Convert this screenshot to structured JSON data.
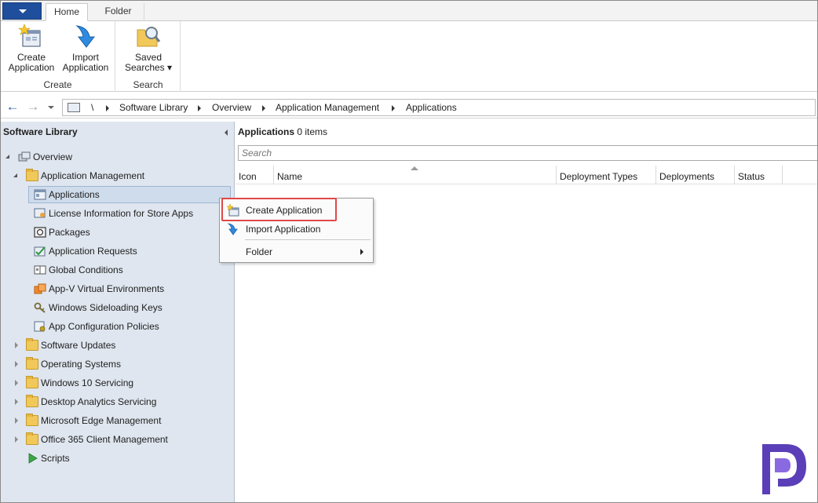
{
  "ribbon": {
    "tabs": [
      {
        "label": "Home",
        "active": true
      },
      {
        "label": "Folder",
        "active": false
      }
    ],
    "groups": {
      "create": {
        "label": "Create",
        "buttons": [
          {
            "label_line1": "Create",
            "label_line2": "Application",
            "icon": "create-application-icon"
          },
          {
            "label_line1": "Import",
            "label_line2": "Application",
            "icon": "import-application-icon"
          }
        ]
      },
      "search": {
        "label": "Search",
        "buttons": [
          {
            "label_line1": "Saved",
            "label_line2": "Searches ▾",
            "icon": "saved-searches-icon"
          }
        ]
      }
    }
  },
  "address_bar": {
    "root": "\\",
    "crumbs": [
      "Software Library",
      "Overview",
      "Application Management",
      "Applications"
    ]
  },
  "left_panel": {
    "title": "Software Library",
    "tree": [
      {
        "label": "Overview",
        "level": 0,
        "expanded": true,
        "icon": "overview-icon"
      },
      {
        "label": "Application Management",
        "level": 1,
        "expanded": true,
        "icon": "folder-icon"
      },
      {
        "label": "Applications",
        "level": 2,
        "selected": true,
        "icon": "applications-icon"
      },
      {
        "label": "License Information for Store Apps",
        "level": 2,
        "icon": "license-icon"
      },
      {
        "label": "Packages",
        "level": 2,
        "icon": "packages-icon"
      },
      {
        "label": "Application Requests",
        "level": 2,
        "icon": "application-requests-icon"
      },
      {
        "label": "Global Conditions",
        "level": 2,
        "icon": "global-conditions-icon"
      },
      {
        "label": "App-V Virtual Environments",
        "level": 2,
        "icon": "appv-icon"
      },
      {
        "label": "Windows Sideloading Keys",
        "level": 2,
        "icon": "sideloading-keys-icon"
      },
      {
        "label": "App Configuration Policies",
        "level": 2,
        "icon": "app-config-icon"
      },
      {
        "label": "Software Updates",
        "level": 1,
        "expanded": false,
        "icon": "folder-icon"
      },
      {
        "label": "Operating Systems",
        "level": 1,
        "expanded": false,
        "icon": "folder-icon"
      },
      {
        "label": "Windows 10 Servicing",
        "level": 1,
        "expanded": false,
        "icon": "folder-icon"
      },
      {
        "label": "Desktop Analytics Servicing",
        "level": 1,
        "expanded": false,
        "icon": "folder-icon"
      },
      {
        "label": "Microsoft Edge Management",
        "level": 1,
        "expanded": false,
        "icon": "folder-icon"
      },
      {
        "label": "Office 365 Client Management",
        "level": 1,
        "expanded": false,
        "icon": "folder-icon"
      },
      {
        "label": "Scripts",
        "level": 1,
        "icon": "scripts-icon"
      }
    ]
  },
  "main": {
    "title": "Applications",
    "count": "0 items",
    "search_placeholder": "Search",
    "columns": [
      "Icon",
      "Name",
      "Deployment Types",
      "Deployments",
      "Status"
    ]
  },
  "context_menu": {
    "items": [
      {
        "label": "Create Application",
        "icon": "create-application-icon"
      },
      {
        "label": "Import Application",
        "icon": "import-application-icon"
      },
      {
        "label": "Folder",
        "submenu": true
      }
    ]
  },
  "colors": {
    "accent": "#1f4e9c",
    "tree_background": "#dfe6ef",
    "highlight_border": "#e04848",
    "logo": "#5a3fb8"
  }
}
